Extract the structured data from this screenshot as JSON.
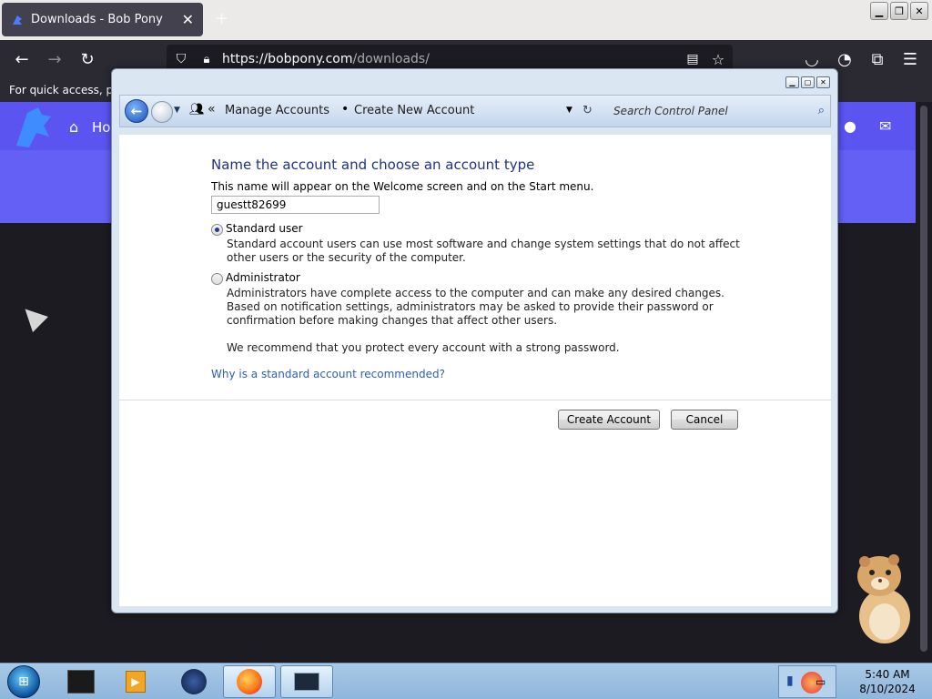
{
  "browser": {
    "tab_title": "Downloads - Bob Pony",
    "url_host": "https://bobpony.com",
    "url_path": "/downloads/",
    "bookmarks_text": "For quick access, plac",
    "page_nav_label": "Ho"
  },
  "dialog": {
    "breadcrumb_manage": "Manage Accounts",
    "breadcrumb_create": "Create New Account",
    "search_placeholder": "Search Control Panel",
    "heading": "Name the account and choose an account type",
    "subtext": "This name will appear on the Welcome screen and on the Start menu.",
    "account_name": "guestt82699",
    "standard_label": "Standard user",
    "standard_desc": "Standard account users can use most software and change system settings that do not affect other users or the security of the computer.",
    "admin_label": "Administrator",
    "admin_desc": "Administrators have complete access to the computer and can make any desired changes. Based on notification settings, administrators may be asked to provide their password or confirmation before making changes that affect other users.",
    "recommend": "We recommend that you protect every account with a strong password.",
    "why_link": "Why is a standard account recommended?",
    "create_button": "Create Account",
    "cancel_button": "Cancel",
    "selected_type": "Standard user"
  },
  "taskbar": {
    "time": "5:40 AM",
    "date": "8/10/2024"
  },
  "colors": {
    "accent": "#5b54f0",
    "heading": "#1e3287",
    "link": "#2c5fb5",
    "browser_dark": "#2b2a33"
  }
}
